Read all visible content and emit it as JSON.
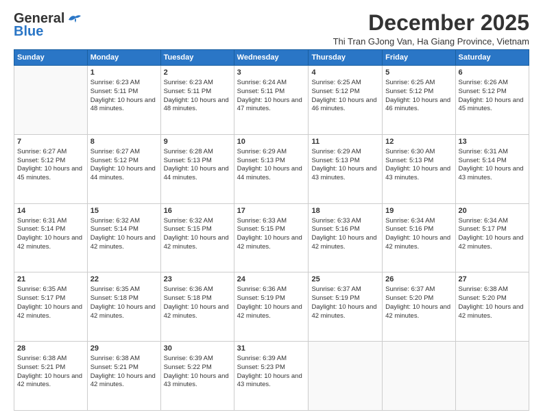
{
  "logo": {
    "general": "General",
    "blue": "Blue"
  },
  "header": {
    "month_title": "December 2025",
    "subtitle": "Thi Tran GJong Van, Ha Giang Province, Vietnam"
  },
  "weekdays": [
    "Sunday",
    "Monday",
    "Tuesday",
    "Wednesday",
    "Thursday",
    "Friday",
    "Saturday"
  ],
  "weeks": [
    [
      {
        "day": "",
        "sunrise": "",
        "sunset": "",
        "daylight": "",
        "empty": true
      },
      {
        "day": "1",
        "sunrise": "Sunrise: 6:23 AM",
        "sunset": "Sunset: 5:11 PM",
        "daylight": "Daylight: 10 hours and 48 minutes."
      },
      {
        "day": "2",
        "sunrise": "Sunrise: 6:23 AM",
        "sunset": "Sunset: 5:11 PM",
        "daylight": "Daylight: 10 hours and 48 minutes."
      },
      {
        "day": "3",
        "sunrise": "Sunrise: 6:24 AM",
        "sunset": "Sunset: 5:11 PM",
        "daylight": "Daylight: 10 hours and 47 minutes."
      },
      {
        "day": "4",
        "sunrise": "Sunrise: 6:25 AM",
        "sunset": "Sunset: 5:12 PM",
        "daylight": "Daylight: 10 hours and 46 minutes."
      },
      {
        "day": "5",
        "sunrise": "Sunrise: 6:25 AM",
        "sunset": "Sunset: 5:12 PM",
        "daylight": "Daylight: 10 hours and 46 minutes."
      },
      {
        "day": "6",
        "sunrise": "Sunrise: 6:26 AM",
        "sunset": "Sunset: 5:12 PM",
        "daylight": "Daylight: 10 hours and 45 minutes."
      }
    ],
    [
      {
        "day": "7",
        "sunrise": "Sunrise: 6:27 AM",
        "sunset": "Sunset: 5:12 PM",
        "daylight": "Daylight: 10 hours and 45 minutes."
      },
      {
        "day": "8",
        "sunrise": "Sunrise: 6:27 AM",
        "sunset": "Sunset: 5:12 PM",
        "daylight": "Daylight: 10 hours and 44 minutes."
      },
      {
        "day": "9",
        "sunrise": "Sunrise: 6:28 AM",
        "sunset": "Sunset: 5:13 PM",
        "daylight": "Daylight: 10 hours and 44 minutes."
      },
      {
        "day": "10",
        "sunrise": "Sunrise: 6:29 AM",
        "sunset": "Sunset: 5:13 PM",
        "daylight": "Daylight: 10 hours and 44 minutes."
      },
      {
        "day": "11",
        "sunrise": "Sunrise: 6:29 AM",
        "sunset": "Sunset: 5:13 PM",
        "daylight": "Daylight: 10 hours and 43 minutes."
      },
      {
        "day": "12",
        "sunrise": "Sunrise: 6:30 AM",
        "sunset": "Sunset: 5:13 PM",
        "daylight": "Daylight: 10 hours and 43 minutes."
      },
      {
        "day": "13",
        "sunrise": "Sunrise: 6:31 AM",
        "sunset": "Sunset: 5:14 PM",
        "daylight": "Daylight: 10 hours and 43 minutes."
      }
    ],
    [
      {
        "day": "14",
        "sunrise": "Sunrise: 6:31 AM",
        "sunset": "Sunset: 5:14 PM",
        "daylight": "Daylight: 10 hours and 42 minutes."
      },
      {
        "day": "15",
        "sunrise": "Sunrise: 6:32 AM",
        "sunset": "Sunset: 5:14 PM",
        "daylight": "Daylight: 10 hours and 42 minutes."
      },
      {
        "day": "16",
        "sunrise": "Sunrise: 6:32 AM",
        "sunset": "Sunset: 5:15 PM",
        "daylight": "Daylight: 10 hours and 42 minutes."
      },
      {
        "day": "17",
        "sunrise": "Sunrise: 6:33 AM",
        "sunset": "Sunset: 5:15 PM",
        "daylight": "Daylight: 10 hours and 42 minutes."
      },
      {
        "day": "18",
        "sunrise": "Sunrise: 6:33 AM",
        "sunset": "Sunset: 5:16 PM",
        "daylight": "Daylight: 10 hours and 42 minutes."
      },
      {
        "day": "19",
        "sunrise": "Sunrise: 6:34 AM",
        "sunset": "Sunset: 5:16 PM",
        "daylight": "Daylight: 10 hours and 42 minutes."
      },
      {
        "day": "20",
        "sunrise": "Sunrise: 6:34 AM",
        "sunset": "Sunset: 5:17 PM",
        "daylight": "Daylight: 10 hours and 42 minutes."
      }
    ],
    [
      {
        "day": "21",
        "sunrise": "Sunrise: 6:35 AM",
        "sunset": "Sunset: 5:17 PM",
        "daylight": "Daylight: 10 hours and 42 minutes."
      },
      {
        "day": "22",
        "sunrise": "Sunrise: 6:35 AM",
        "sunset": "Sunset: 5:18 PM",
        "daylight": "Daylight: 10 hours and 42 minutes."
      },
      {
        "day": "23",
        "sunrise": "Sunrise: 6:36 AM",
        "sunset": "Sunset: 5:18 PM",
        "daylight": "Daylight: 10 hours and 42 minutes."
      },
      {
        "day": "24",
        "sunrise": "Sunrise: 6:36 AM",
        "sunset": "Sunset: 5:19 PM",
        "daylight": "Daylight: 10 hours and 42 minutes."
      },
      {
        "day": "25",
        "sunrise": "Sunrise: 6:37 AM",
        "sunset": "Sunset: 5:19 PM",
        "daylight": "Daylight: 10 hours and 42 minutes."
      },
      {
        "day": "26",
        "sunrise": "Sunrise: 6:37 AM",
        "sunset": "Sunset: 5:20 PM",
        "daylight": "Daylight: 10 hours and 42 minutes."
      },
      {
        "day": "27",
        "sunrise": "Sunrise: 6:38 AM",
        "sunset": "Sunset: 5:20 PM",
        "daylight": "Daylight: 10 hours and 42 minutes."
      }
    ],
    [
      {
        "day": "28",
        "sunrise": "Sunrise: 6:38 AM",
        "sunset": "Sunset: 5:21 PM",
        "daylight": "Daylight: 10 hours and 42 minutes."
      },
      {
        "day": "29",
        "sunrise": "Sunrise: 6:38 AM",
        "sunset": "Sunset: 5:21 PM",
        "daylight": "Daylight: 10 hours and 42 minutes."
      },
      {
        "day": "30",
        "sunrise": "Sunrise: 6:39 AM",
        "sunset": "Sunset: 5:22 PM",
        "daylight": "Daylight: 10 hours and 43 minutes."
      },
      {
        "day": "31",
        "sunrise": "Sunrise: 6:39 AM",
        "sunset": "Sunset: 5:23 PM",
        "daylight": "Daylight: 10 hours and 43 minutes."
      },
      {
        "day": "",
        "sunrise": "",
        "sunset": "",
        "daylight": "",
        "empty": true
      },
      {
        "day": "",
        "sunrise": "",
        "sunset": "",
        "daylight": "",
        "empty": true
      },
      {
        "day": "",
        "sunrise": "",
        "sunset": "",
        "daylight": "",
        "empty": true
      }
    ]
  ]
}
